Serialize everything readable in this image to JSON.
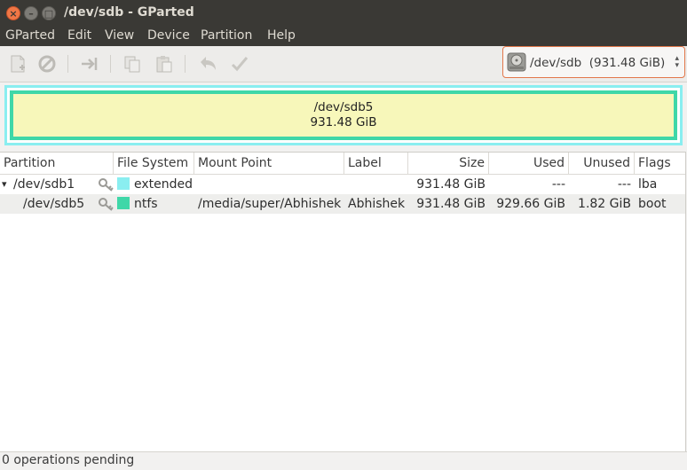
{
  "window": {
    "title": "/dev/sdb - GParted",
    "close_glyph": "×",
    "minimize_glyph": "–",
    "maximize_glyph": "□"
  },
  "menu": [
    "GParted",
    "Edit",
    "View",
    "Device",
    "Partition",
    "Help"
  ],
  "toolbar": {
    "icons": [
      "new-partition-icon",
      "delete-icon",
      "resize-move-icon",
      "copy-icon",
      "paste-icon",
      "undo-icon",
      "apply-icon"
    ]
  },
  "device_selector": {
    "label": "/dev/sdb  (931.48 GiB)",
    "icon": "harddisk-icon"
  },
  "partition_map": {
    "name": "/dev/sdb5",
    "size": "931.48 GiB",
    "outer_color": "#8aeef0",
    "inner_color": "#3fd7a8",
    "fill_color": "#f7f7ba"
  },
  "table": {
    "columns": [
      "Partition",
      "File System",
      "Mount Point",
      "Label",
      "Size",
      "Used",
      "Unused",
      "Flags"
    ],
    "rows": [
      {
        "expander": "▾",
        "partition": "/dev/sdb1",
        "fs": "extended",
        "fs_color": "#8aeef0",
        "mount": "",
        "label": "",
        "size": "931.48 GiB",
        "used": "---",
        "unused": "---",
        "flags": "lba"
      },
      {
        "expander": "",
        "partition": "/dev/sdb5",
        "fs": "ntfs",
        "fs_color": "#3fd7a8",
        "mount": "/media/super/Abhishek",
        "label": "Abhishek",
        "size": "931.48 GiB",
        "used": "929.66 GiB",
        "unused": "1.82 GiB",
        "flags": "boot"
      }
    ]
  },
  "status": "0 operations pending"
}
